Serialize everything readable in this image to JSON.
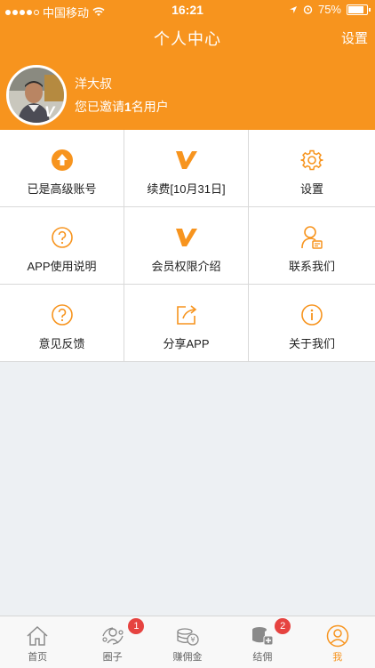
{
  "status": {
    "carrier": "中国移动",
    "time": "16:21",
    "battery": "75%"
  },
  "header": {
    "title": "个人中心",
    "settings_label": "设置"
  },
  "profile": {
    "name": "洋大叔",
    "invite_prefix": "您已邀请",
    "invite_count": "1",
    "invite_suffix": "名用户"
  },
  "menu": [
    {
      "label": "已是高级账号",
      "icon": "upgrade-arrow-icon"
    },
    {
      "label": "续费[10月31日]",
      "icon": "v-vip-icon"
    },
    {
      "label": "设置",
      "icon": "gear-icon"
    },
    {
      "label": "APP使用说明",
      "icon": "question-icon"
    },
    {
      "label": "会员权限介绍",
      "icon": "v-vip-icon"
    },
    {
      "label": "联系我们",
      "icon": "contact-person-icon"
    },
    {
      "label": "意见反馈",
      "icon": "question-icon"
    },
    {
      "label": "分享APP",
      "icon": "share-icon"
    },
    {
      "label": "关于我们",
      "icon": "info-icon"
    }
  ],
  "tabs": [
    {
      "label": "首页",
      "icon": "home-icon",
      "badge": ""
    },
    {
      "label": "圈子",
      "icon": "circle-icon",
      "badge": "1"
    },
    {
      "label": "赚佣金",
      "icon": "coins-icon",
      "badge": ""
    },
    {
      "label": "结佣",
      "icon": "settle-icon",
      "badge": "2"
    },
    {
      "label": "我",
      "icon": "profile-icon",
      "badge": ""
    }
  ],
  "colors": {
    "accent": "#f7941e",
    "badge": "#e64340"
  }
}
